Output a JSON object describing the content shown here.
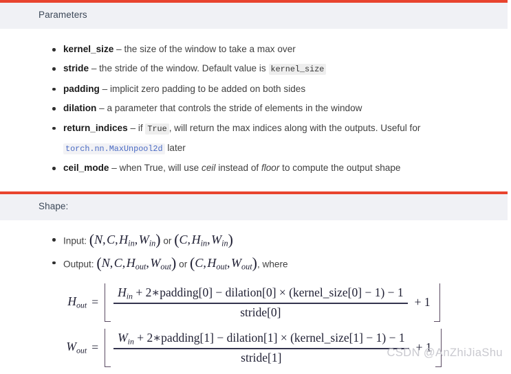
{
  "parameters_panel": {
    "title": "Parameters",
    "accent_color": "#e8442e",
    "header_bg": "#f0f1f5",
    "items": [
      {
        "name": "kernel_size",
        "dash": "–",
        "desc": "the size of the window to take a max over"
      },
      {
        "name": "stride",
        "dash": "–",
        "desc_before": "the stride of the window. Default value is",
        "code": "kernel_size"
      },
      {
        "name": "padding",
        "dash": "–",
        "desc": "implicit zero padding to be added on both sides"
      },
      {
        "name": "dilation",
        "dash": "–",
        "desc": "a parameter that controls the stride of elements in the window"
      },
      {
        "name": "return_indices",
        "dash": "–",
        "desc_before": "if",
        "code": "True",
        "desc_mid": ", will return the max indices along with the outputs. Useful for",
        "link": "torch.nn.MaxUnpool2d",
        "desc_after": "later"
      },
      {
        "name": "ceil_mode",
        "dash": "–",
        "desc_before": "when True, will use",
        "italic1": "ceil",
        "desc_mid": "instead of",
        "italic2": "floor",
        "desc_after": "to compute the output shape"
      }
    ]
  },
  "shape_panel": {
    "title": "Shape:",
    "accent_color": "#e8442e",
    "header_bg": "#f0f1f5",
    "input": {
      "label": "Input:",
      "tuple1": "(N, C, H_in, W_in)",
      "conjunction": "or",
      "tuple2": "(C, H_in, W_in)"
    },
    "output": {
      "label": "Output:",
      "tuple1": "(N, C, H_out, W_out)",
      "conjunction": "or",
      "tuple2": "(C, H_out, W_out)",
      "trailing": ", where"
    },
    "formulas": [
      {
        "lhs_var": "H",
        "lhs_sub": "out",
        "eq": "=",
        "numerator": "H_in + 2 * padding[0] − dilation[0] × (kernel_size[0] − 1) − 1",
        "denominator": "stride[0]",
        "plus_one": "+ 1",
        "num_parts": {
          "var": "H",
          "var_sub": "in",
          "plus": "+",
          "two": "2",
          "times": "∗",
          "padding": "padding[0]",
          "minus1": "−",
          "dilation": "dilation[0]",
          "cross": "×",
          "kernel": "(kernel_size[0]",
          "minus2": "− 1)",
          "minus3": "− 1"
        }
      },
      {
        "lhs_var": "W",
        "lhs_sub": "out",
        "eq": "=",
        "numerator": "W_in + 2 * padding[1] − dilation[1] × (kernel_size[1] − 1) − 1",
        "denominator": "stride[1]",
        "plus_one": "+ 1",
        "num_parts": {
          "var": "W",
          "var_sub": "in",
          "plus": "+",
          "two": "2",
          "times": "∗",
          "padding": "padding[1]",
          "minus1": "−",
          "dilation": "dilation[1]",
          "cross": "×",
          "kernel": "(kernel_size[1]",
          "minus2": "− 1)",
          "minus3": "− 1"
        }
      }
    ]
  },
  "watermark": {
    "text": "CSDN @AnZhiJiaShu"
  }
}
